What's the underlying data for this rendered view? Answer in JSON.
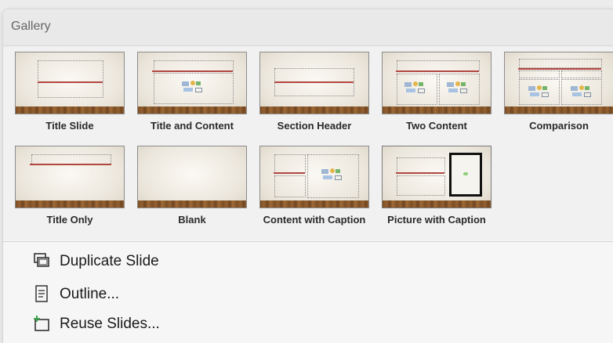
{
  "gallery": {
    "title": "Gallery",
    "layouts": [
      {
        "label": "Title Slide",
        "layout": "title-slide"
      },
      {
        "label": "Title and Content",
        "layout": "title-content"
      },
      {
        "label": "Section Header",
        "layout": "section-header"
      },
      {
        "label": "Two Content",
        "layout": "two-content"
      },
      {
        "label": "Comparison",
        "layout": "comparison"
      },
      {
        "label": "Title Only",
        "layout": "title-only"
      },
      {
        "label": "Blank",
        "layout": "blank"
      },
      {
        "label": "Content with Caption",
        "layout": "content-caption"
      },
      {
        "label": "Picture with Caption",
        "layout": "picture-caption"
      }
    ]
  },
  "menu": {
    "items": [
      {
        "label": "Duplicate Slide",
        "icon": "duplicate-slide-icon"
      },
      {
        "label": "Outline...",
        "icon": "outline-icon"
      },
      {
        "label": "Reuse Slides...",
        "icon": "reuse-slides-icon"
      }
    ]
  },
  "colors": {
    "panel_bg": "#f6f6f6",
    "header_bg": "#e9e9e9",
    "accent_red": "#b24640",
    "wood": "#8a5a2c"
  }
}
